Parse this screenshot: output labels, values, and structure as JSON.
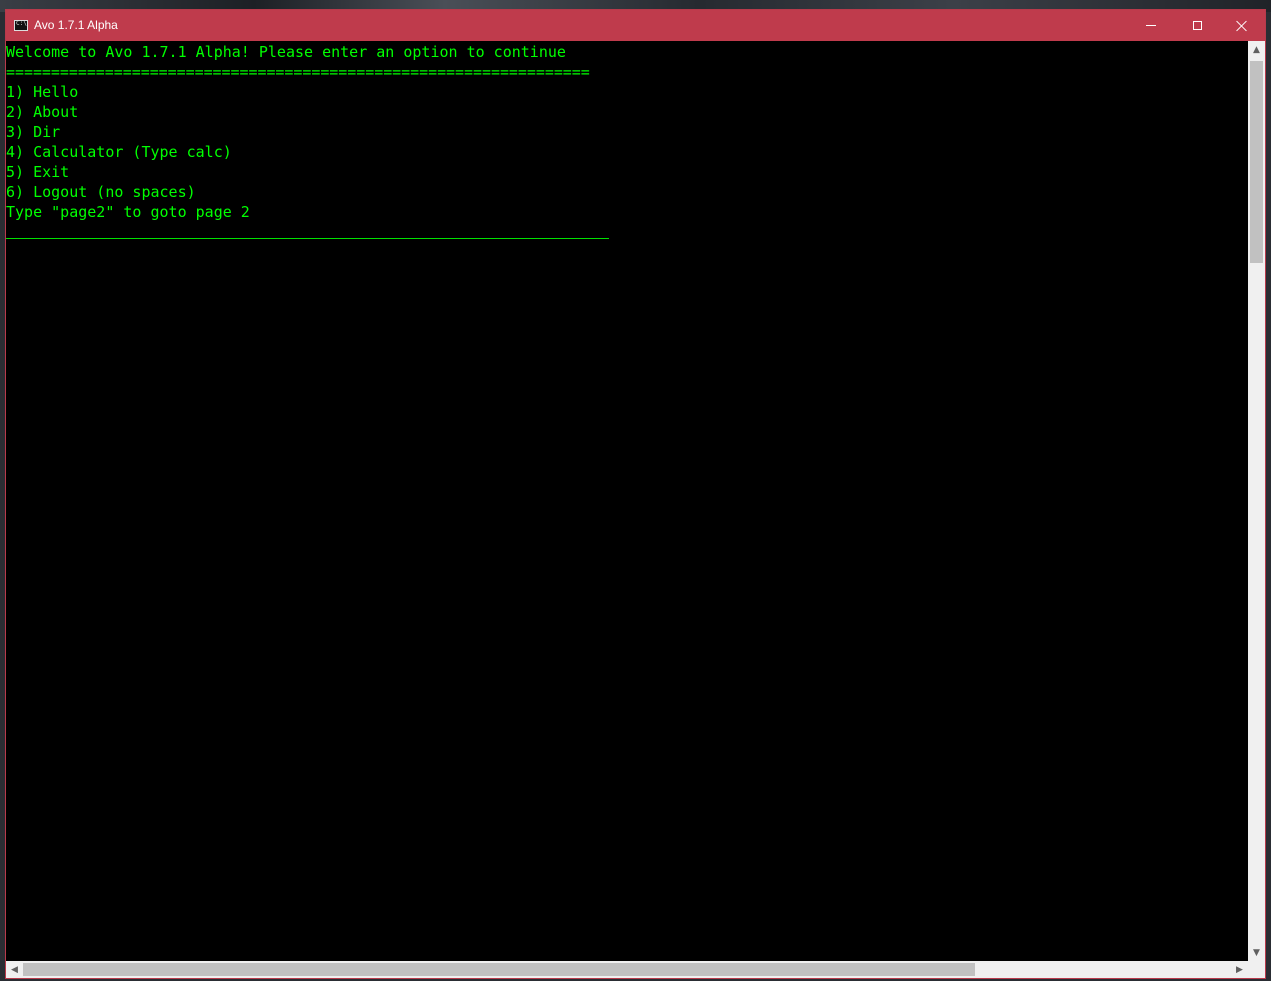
{
  "window": {
    "title": "Avo 1.7.1 Alpha",
    "title_bar_color": "#bf3b4c",
    "icon": "console-app-icon"
  },
  "console": {
    "text_color": "#00ff00",
    "background_color": "#000000",
    "lines": [
      "Welcome to Avo 1.7.1 Alpha! Please enter an option to continue",
      "=================================================================",
      "1) Hello",
      "2) About",
      "3) Dir",
      "4) Calculator (Type calc)",
      "5) Exit",
      "6) Logout (no spaces)",
      "Type \"page2\" to goto page 2"
    ]
  },
  "scrollbars": {
    "up_arrow": "▲",
    "down_arrow": "▼",
    "left_arrow": "◀",
    "right_arrow": "▶"
  }
}
